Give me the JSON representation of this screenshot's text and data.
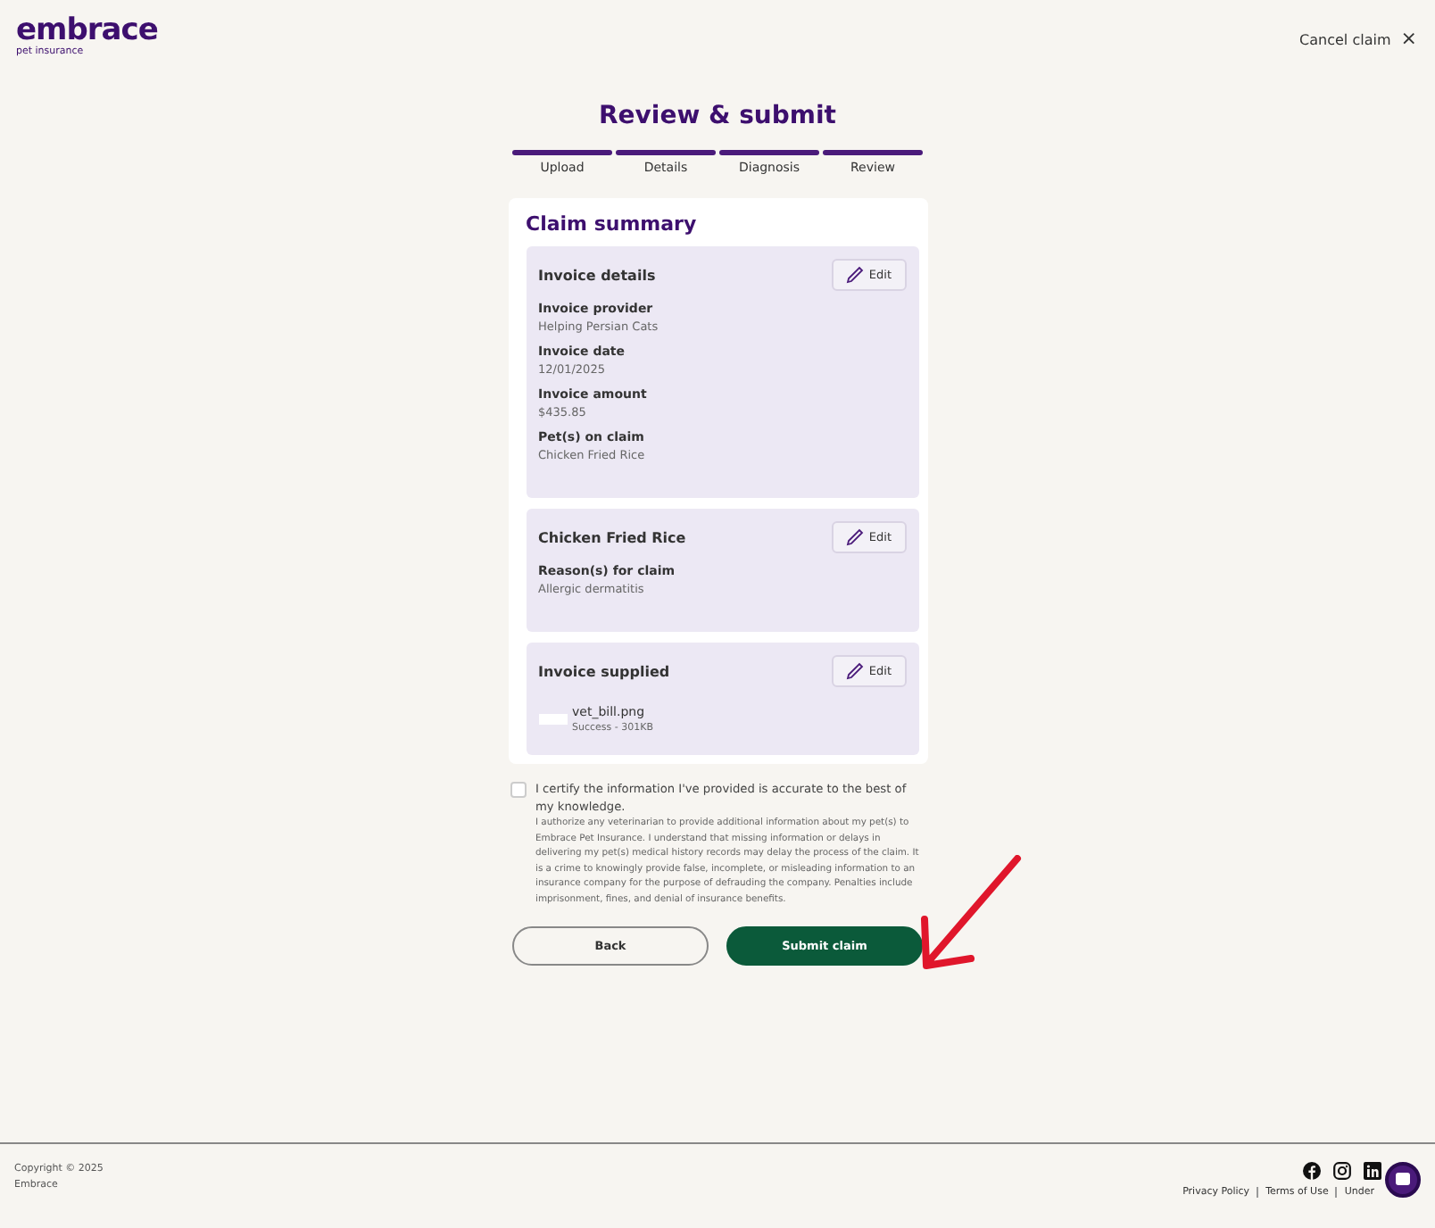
{
  "header": {
    "logo": "embrace",
    "logo_sub": "pet insurance",
    "cancel": "Cancel claim",
    "cancel_icon": "×"
  },
  "title": "Review & submit",
  "steps": [
    {
      "label": "Upload",
      "completed": true
    },
    {
      "label": "Details",
      "completed": true
    },
    {
      "label": "Diagnosis",
      "completed": true
    },
    {
      "label": "Review",
      "completed": true
    }
  ],
  "summary": {
    "title": "Claim summary",
    "sections": [
      {
        "kind": "fields",
        "title": "Invoice details",
        "edit": "Edit",
        "fields": [
          {
            "label": "Invoice provider",
            "value": "Helping Persian Cats"
          },
          {
            "label": "Invoice date",
            "value": "12/01/2025"
          },
          {
            "label": "Invoice amount",
            "value": "$435.85"
          },
          {
            "label": "Pet(s) on claim",
            "value": "Chicken Fried Rice"
          }
        ]
      },
      {
        "kind": "fields",
        "title": "Chicken Fried Rice",
        "edit": "Edit",
        "fields": [
          {
            "label": "Reason(s) for claim",
            "value": "Allergic dermatitis"
          }
        ]
      },
      {
        "kind": "file",
        "title": "Invoice supplied",
        "edit": "Edit",
        "file": {
          "name": "vet_bill.png",
          "status": "Success - 301KB"
        }
      }
    ]
  },
  "certify": {
    "checked": false,
    "label": "I certify the information I've provided is accurate to the best of my knowledge.",
    "text": "I authorize any veterinarian to provide additional information about my pet(s) to Embrace Pet Insurance. I understand that missing information or delays in delivering my pet(s) medical history records may delay the process of the claim. It is a crime to knowingly provide false, incomplete, or misleading information to an insurance company for the purpose of defrauding the company. Penalties include imprisonment, fines, and denial of insurance benefits."
  },
  "buttons": {
    "back": "Back",
    "submit": "Submit claim"
  },
  "footer": {
    "copyright": "Copyright © 2025",
    "company": "Embrace",
    "links": [
      "Privacy Policy",
      "Terms of Use",
      "Under"
    ]
  }
}
